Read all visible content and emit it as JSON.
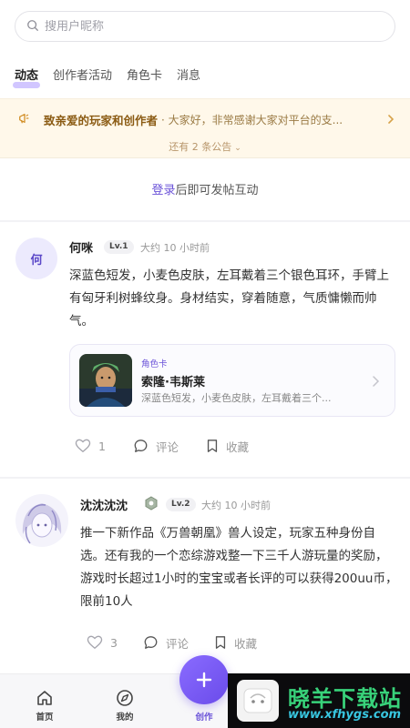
{
  "search": {
    "placeholder": "搜用户昵称"
  },
  "tabs": [
    {
      "label": "动态",
      "active": true
    },
    {
      "label": "创作者活动",
      "active": false
    },
    {
      "label": "角色卡",
      "active": false
    },
    {
      "label": "消息",
      "active": false
    }
  ],
  "notice": {
    "title": "致亲爱的玩家和创作者",
    "text": "· 大家好，非常感谢大家对平台的支...",
    "more": "还有 2 条公告",
    "icon": "megaphone-icon"
  },
  "login": {
    "link": "登录",
    "rest": "后即可发帖互动"
  },
  "posts": [
    {
      "avatar_text": "何",
      "author": "何咪",
      "level": "Lv.1",
      "time": "大约 10 小时前",
      "content": "深蓝色短发，小麦色皮肤，左耳戴着三个银色耳环，手臂上有匈牙利树蜂纹身。身材结实，穿着随意，气质慵懒而帅气。",
      "card": {
        "tag": "角色卡",
        "title": "索隆·韦斯莱",
        "desc": "深蓝色短发，小麦色皮肤，左耳戴着三个..."
      },
      "likes": "1",
      "comment_label": "评论",
      "collect_label": "收藏"
    },
    {
      "author": "沈沈沈沈",
      "level": "Lv.2",
      "time": "大约 10 小时前",
      "content": "推一下新作品《万兽朝凰》兽人设定，玩家五种身份自选。还有我的一个恋综游戏整一下三千人游玩量的奖励，游戏时长超过1小时的宝宝或者长评的可以获得200uu币，限前10人",
      "likes": "3",
      "comment_label": "评论",
      "collect_label": "收藏"
    }
  ],
  "nav": {
    "home": "首页",
    "mine": "我的",
    "create": "创作"
  },
  "watermark": {
    "title": "晓羊下载站",
    "url": "www.xfhygs.com"
  },
  "colors": {
    "accent": "#6a52d8",
    "notice_bg": "#fff8ea",
    "notice_title": "#8a5a12"
  }
}
